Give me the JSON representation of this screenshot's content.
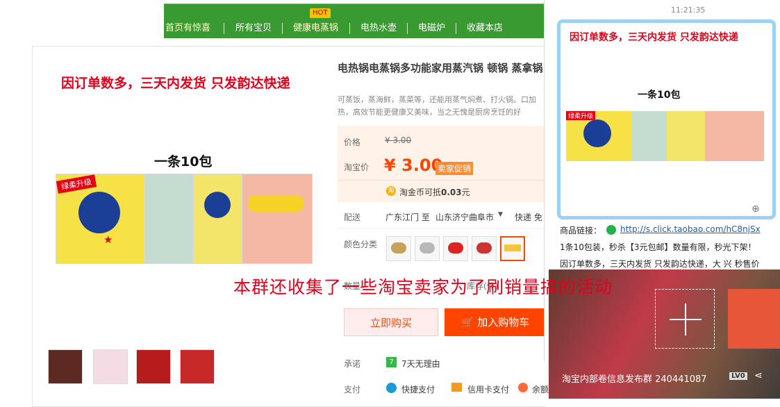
{
  "nav": {
    "items": [
      "首页有惊喜",
      "所有宝贝",
      "健康电蒸锅",
      "电热水壶",
      "电磁炉",
      "收藏本店"
    ],
    "hot_badge": "HOT"
  },
  "product": {
    "banner_text": "因订单数多，三天内发货  只发韵达快递",
    "pack_text": "一条10包",
    "pack_badge": "绿柔升级",
    "title": "电热锅电蒸锅多功能家用蒸汽锅 顿锅 蒸拿锅",
    "desc": "可蒸饭，蒸海鲜，蒸菜等，还能用蒸气焖煮、打火锅。口加热，高效节能更健康又美味，当之无愧是厨房烹饪的好",
    "price_label": "价格",
    "price_old": "¥ 3.00",
    "tb_price_label": "淘宝价",
    "tb_price": "¥ 3.00",
    "promo_tag": "卖家促销",
    "coin_text": "淘金币可抵",
    "coin_value": "0.03",
    "coin_unit": "元",
    "ship_label": "配送",
    "ship_from": "广东江门 至",
    "ship_to": "山东济宁曲阜市",
    "ship_method": "快递 免",
    "color_label": "颜色分类",
    "qty_label": "数量",
    "qty_stock": "库存(件)",
    "buy_now": "立即购买",
    "add_cart": "加入购物车",
    "promise_label": "承诺",
    "promise_value": "7天无理由",
    "pay_label": "支付",
    "pay_options": [
      "快捷支付",
      "信用卡支付",
      "余额"
    ]
  },
  "chat": {
    "time": "11:21:35",
    "bubble_banner": "因订单数多，三天内发货  只发韵达快递",
    "bubble_pack": "一条10包",
    "link_label": "商品链接：",
    "link_url": "http://s.click.taobao.com/hC8njSx",
    "message": "1条10包装，秒杀【3元包邮】数量有限，秒光下架！",
    "message2": "因订单数多，三天内发货 只发韵达快递，大 兴 秒售价"
  },
  "overlay_text": "本群还收集了一些淘宝卖家为了刷销量搞的活动",
  "video": {
    "group_name": "淘宝内部卷信息发布群 240441087",
    "level": "LV0"
  },
  "colors": {
    "accent": "#ff4400",
    "nav_green": "#3a9a32",
    "red": "#e2001a",
    "chat_border": "#9cd1f5"
  }
}
